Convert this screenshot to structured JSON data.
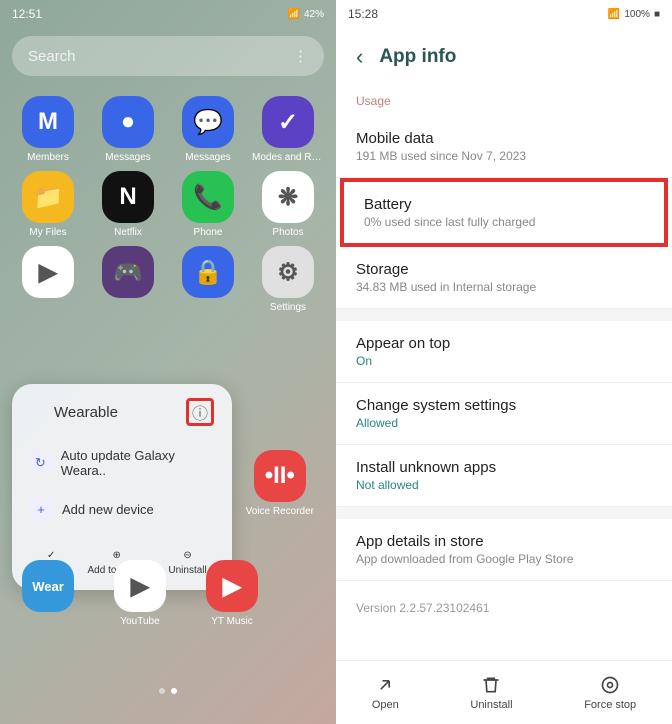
{
  "left": {
    "time": "12:51",
    "battery": "42%",
    "search_placeholder": "Search",
    "apps_row1": [
      {
        "label": "Members",
        "bg": "#3866e6",
        "letter": "M"
      },
      {
        "label": "Messages",
        "bg": "#3866e6",
        "letter": "●"
      },
      {
        "label": "Messages",
        "bg": "#3866e6",
        "letter": "💬"
      },
      {
        "label": "Modes and Rout..",
        "bg": "#5b42c4",
        "letter": "✓"
      }
    ],
    "apps_row2": [
      {
        "label": "My Files",
        "bg": "#f5b820",
        "letter": "📁"
      },
      {
        "label": "Netflix",
        "bg": "#111",
        "letter": "N"
      },
      {
        "label": "Phone",
        "bg": "#28c153",
        "letter": "📞"
      },
      {
        "label": "Photos",
        "bg": "#fff",
        "letter": "❋"
      }
    ],
    "apps_row3": [
      {
        "label": "",
        "bg": "#fff",
        "letter": "▶"
      },
      {
        "label": "",
        "bg": "#5a3a7a",
        "letter": "🎮"
      },
      {
        "label": "",
        "bg": "#3866e6",
        "letter": "🔒"
      },
      {
        "label": "Settings",
        "bg": "#e0e0e0",
        "letter": "⚙"
      }
    ],
    "sideapp": {
      "label": "Voice Recorder",
      "bg": "#e84545",
      "letter": "🎙"
    },
    "apps_row5": [
      {
        "label": "",
        "bg": "#3498db",
        "letter": "Wear",
        "text": true
      },
      {
        "label": "YouTube",
        "bg": "#fff",
        "letter": "▶"
      },
      {
        "label": "YT Music",
        "bg": "#e84545",
        "letter": "▶"
      }
    ],
    "popup": {
      "title": "Wearable",
      "item1": "Auto update Galaxy Weara..",
      "item2": "Add new device",
      "action1": "Select",
      "action2": "Add to Home",
      "action3": "Uninstall"
    }
  },
  "right": {
    "time": "15:28",
    "battery": "100%",
    "title": "App info",
    "usage_label": "Usage",
    "items": {
      "mobile": {
        "title": "Mobile data",
        "sub": "191 MB used since Nov 7, 2023"
      },
      "battery": {
        "title": "Battery",
        "sub": "0% used since last fully charged"
      },
      "storage": {
        "title": "Storage",
        "sub": "34.83 MB used in Internal storage"
      },
      "appear": {
        "title": "Appear on top",
        "sub": "On"
      },
      "change": {
        "title": "Change system settings",
        "sub": "Allowed"
      },
      "install": {
        "title": "Install unknown apps",
        "sub": "Not allowed"
      },
      "details": {
        "title": "App details in store",
        "sub": "App downloaded from Google Play Store"
      }
    },
    "version": "Version 2.2.57.23102461",
    "actions": {
      "open": "Open",
      "uninstall": "Uninstall",
      "forcestop": "Force stop"
    }
  }
}
